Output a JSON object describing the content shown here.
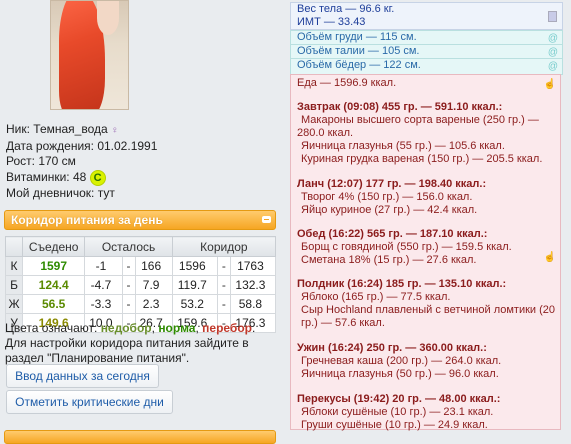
{
  "profile": {
    "nick_label": "Ник:",
    "nick": "Темная_вода",
    "birth_label": "Дата рождения:",
    "birth": "01.02.1991",
    "height_label": "Рост:",
    "height": "170 см",
    "vitamins_label": "Витаминки:",
    "vitamins": "48",
    "vitamin_badge": "C",
    "diary_label": "Мой дневничок:",
    "diary": "тут",
    "gender_symbol": "♀"
  },
  "corridor": {
    "title": "Коридор питания за день",
    "headers": [
      "Съедено",
      "Осталось",
      "Коридор"
    ],
    "rows": [
      {
        "k": "К",
        "eaten": "1597",
        "left_a": "-1",
        "left_b": "166",
        "c_a": "1596",
        "c_b": "1763"
      },
      {
        "k": "Б",
        "eaten": "124.4",
        "left_a": "-4.7",
        "left_b": "7.9",
        "c_a": "119.7",
        "c_b": "132.3"
      },
      {
        "k": "Ж",
        "eaten": "56.5",
        "left_a": "-3.3",
        "left_b": "2.3",
        "c_a": "53.2",
        "c_b": "58.8"
      },
      {
        "k": "У",
        "eaten": "149.6",
        "left_a": "10.0",
        "left_b": "26.7",
        "c_a": "159.6",
        "c_b": "176.3"
      }
    ],
    "sep": "-"
  },
  "legend": {
    "prefix": "Цвета означают:",
    "under": "недобор",
    "norm": "норма",
    "over": "перебор",
    "hint": "Для настройки коридора питания зайдите в раздел \"Планирование питания\"."
  },
  "buttons": {
    "enter_today": "Ввод данных за сегодня",
    "critical_days": "Отметить критические дни"
  },
  "stats": {
    "weight": "Вес тела — 96.6 кг.",
    "bmi": "ИМТ — 33.43",
    "chest": "Объём груди — 115 см.",
    "waist": "Объём талии — 105 см.",
    "hips": "Объём бёдер — 122 см."
  },
  "food": {
    "total": "Еда — 1596.9 ккал.",
    "meals": [
      {
        "header": "Завтрак (09:08) 455 гр. — 591.10 ккал.:",
        "items": [
          "Макароны высшего сорта вареные (250 гр.) —",
          "280.0 ккал.",
          "Яичница глазунья (55 гр.) — 105.6 ккал.",
          "Куриная грудка вареная (150 гр.) — 205.5 ккал."
        ]
      },
      {
        "header": "Ланч (12:07) 177 гр. — 198.40 ккал.:",
        "items": [
          "Творог 4% (150 гр.) — 156.0 ккал.",
          "Яйцо куриное (27 гр.) — 42.4 ккал."
        ]
      },
      {
        "header": "Обед (16:22) 565 гр. — 187.10 ккал.:",
        "items": [
          "Борщ с говядиной (550 гр.) — 159.5 ккал.",
          "Сметана 18% (15 гр.) — 27.6 ккал."
        ]
      },
      {
        "header": "Полдник (16:24) 185 гр. — 135.10 ккал.:",
        "items": [
          "Яблоко (165 гр.) — 77.5 ккал.",
          "Сыр Hochland плавленый с ветчиной ломтики (20",
          "гр.) — 57.6 ккал."
        ]
      },
      {
        "header": "Ужин (16:24) 250 гр. — 360.00 ккал.:",
        "items": [
          "Гречневая каша (200 гр.) — 264.0 ккал.",
          "Яичница глазунья (50 гр.) — 96.0 ккал."
        ]
      },
      {
        "header": "Перекусы (19:42) 20 гр. — 48.00 ккал.:",
        "items": [
          "Яблоки сушёные (10 гр.) — 23.1 ккал.",
          "Груши сушёные (10 гр.) — 24.9 ккал."
        ]
      }
    ]
  },
  "icons": {
    "collapse": "minus-icon",
    "stat": "document-icon",
    "measure": "swirl-icon",
    "food": "hand-icon"
  }
}
